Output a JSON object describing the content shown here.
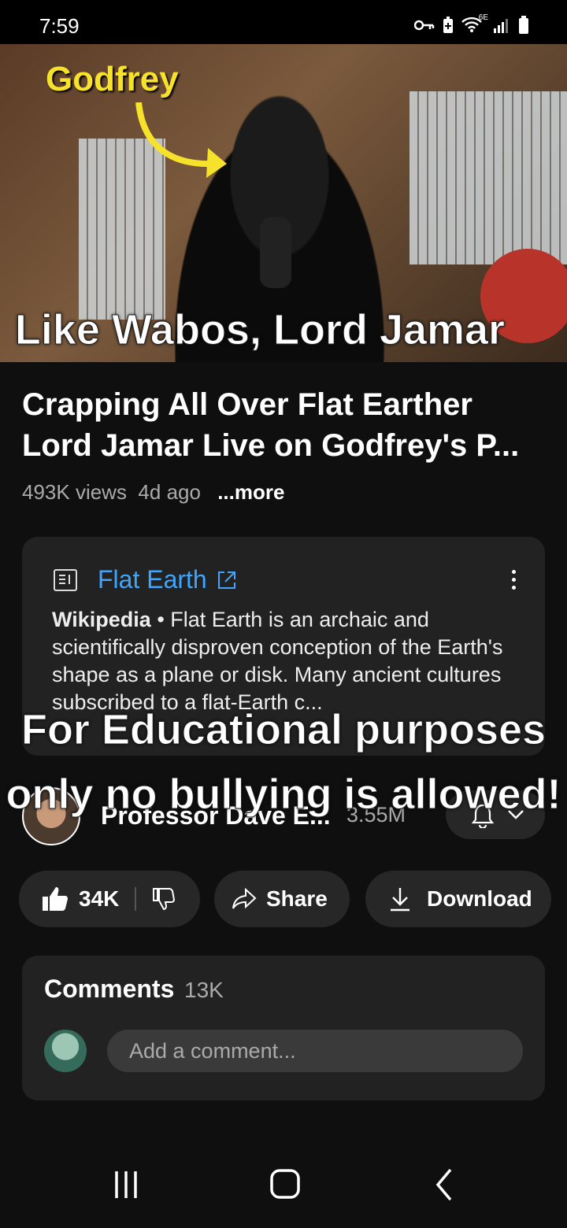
{
  "status_bar": {
    "time": "7:59",
    "icons": [
      "vpn-key-icon",
      "battery-saver-icon",
      "wifi-6e-icon",
      "signal-icon",
      "battery-icon"
    ],
    "wifi_label": "6E"
  },
  "video": {
    "tag": "Godfrey",
    "caption": "Like Wabos, Lord Jamar Crashes Out!"
  },
  "title": "Crapping All Over Flat Earther Lord Jamar Live on Godfrey's P...",
  "meta": {
    "views": "493K views",
    "age": "4d ago",
    "more": "...more"
  },
  "info_card": {
    "title": "Flat Earth",
    "source": "Wikipedia",
    "separator": "•",
    "text": "Flat Earth is an archaic and scientifically disproven conception of the Earth's shape as a plane or disk. Many ancient cultures subscribed to a flat-Earth c..."
  },
  "overlay_caption": "For Educational purposes only no bullying is allowed!",
  "channel": {
    "name": "Professor Dave E...",
    "subscribers": "3.55M"
  },
  "actions": {
    "likes": "34K",
    "share": "Share",
    "download": "Download"
  },
  "comments": {
    "title": "Comments",
    "count": "13K",
    "placeholder": "Add a comment..."
  },
  "colors": {
    "background": "#0f0f0f",
    "card": "#222222",
    "link": "#3ea6ff",
    "tag_yellow": "#f7e22b"
  }
}
